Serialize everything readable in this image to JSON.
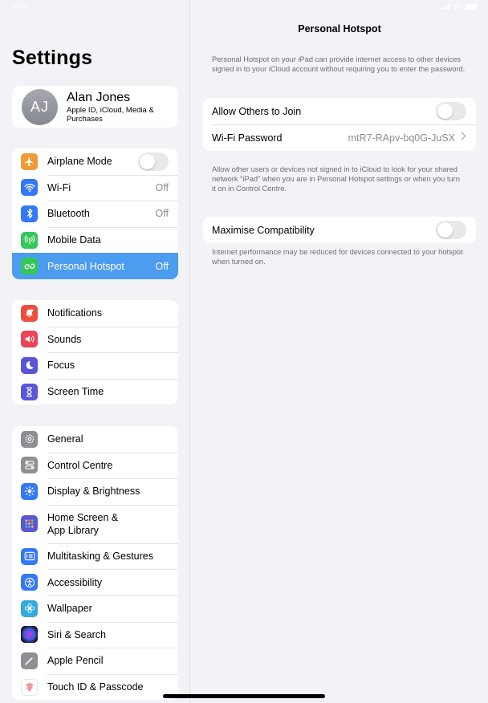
{
  "status": {
    "time": "10:00",
    "network": "5G"
  },
  "sidebar": {
    "title": "Settings",
    "profile": {
      "initials": "AJ",
      "name": "Alan Jones",
      "subtitle": "Apple ID, iCloud, Media & Purchases"
    },
    "group1": [
      {
        "label": "Airplane Mode",
        "value": "",
        "icon": "airplane-icon",
        "color": "#f09a37"
      },
      {
        "label": "Wi-Fi",
        "value": "Off",
        "icon": "wifi-icon",
        "color": "#3478f6"
      },
      {
        "label": "Bluetooth",
        "value": "Off",
        "icon": "bluetooth-icon",
        "color": "#3478f6"
      },
      {
        "label": "Mobile Data",
        "value": "",
        "icon": "antenna-icon",
        "color": "#34c759"
      },
      {
        "label": "Personal Hotspot",
        "value": "Off",
        "icon": "hotspot-icon",
        "color": "#34c759"
      }
    ],
    "group2": [
      {
        "label": "Notifications",
        "icon": "bell-icon",
        "color": "#eb4e3d"
      },
      {
        "label": "Sounds",
        "icon": "speaker-icon",
        "color": "#eb445a"
      },
      {
        "label": "Focus",
        "icon": "moon-icon",
        "color": "#5856d6"
      },
      {
        "label": "Screen Time",
        "icon": "hourglass-icon",
        "color": "#5856d6"
      }
    ],
    "group3": [
      {
        "label": "General",
        "icon": "gear-icon",
        "color": "#8e8e93"
      },
      {
        "label": "Control Centre",
        "icon": "switches-icon",
        "color": "#8e8e93"
      },
      {
        "label": "Display & Brightness",
        "icon": "sun-icon",
        "color": "#3478f6"
      },
      {
        "label": "Home Screen &",
        "label2": "App Library",
        "icon": "grid-icon",
        "color": "#5856d6"
      },
      {
        "label": "Multitasking & Gestures",
        "icon": "multitasking-icon",
        "color": "#3478f6"
      },
      {
        "label": "Accessibility",
        "icon": "accessibility-icon",
        "color": "#3478f6"
      },
      {
        "label": "Wallpaper",
        "icon": "flower-icon",
        "color": "#35aadc"
      },
      {
        "label": "Siri & Search",
        "icon": "siri-icon",
        "color": "#222222"
      },
      {
        "label": "Apple Pencil",
        "icon": "pencil-icon",
        "color": "#8e8e93"
      },
      {
        "label": "Touch ID & Passcode",
        "icon": "fingerprint-icon",
        "color": "#ffffff"
      }
    ]
  },
  "detail": {
    "title": "Personal Hotspot",
    "intro": "Personal Hotspot on your iPad can provide internet access to other devices signed in to your iCloud account without requiring you to enter the password.",
    "allow_label": "Allow Others to Join",
    "wifi_label": "Wi-Fi Password",
    "wifi_value": "mtR7-RApv-bq0G-JuSX",
    "allow_note": "Allow other users or devices not signed in to iCloud to look for your shared network \"iPad\" when you are in Personal Hotspot settings or when you turn it on in Control Centre.",
    "compat_label": "Maximise Compatibility",
    "compat_note": "Internet performance may be reduced for devices connected to your hotspot when turned on."
  }
}
